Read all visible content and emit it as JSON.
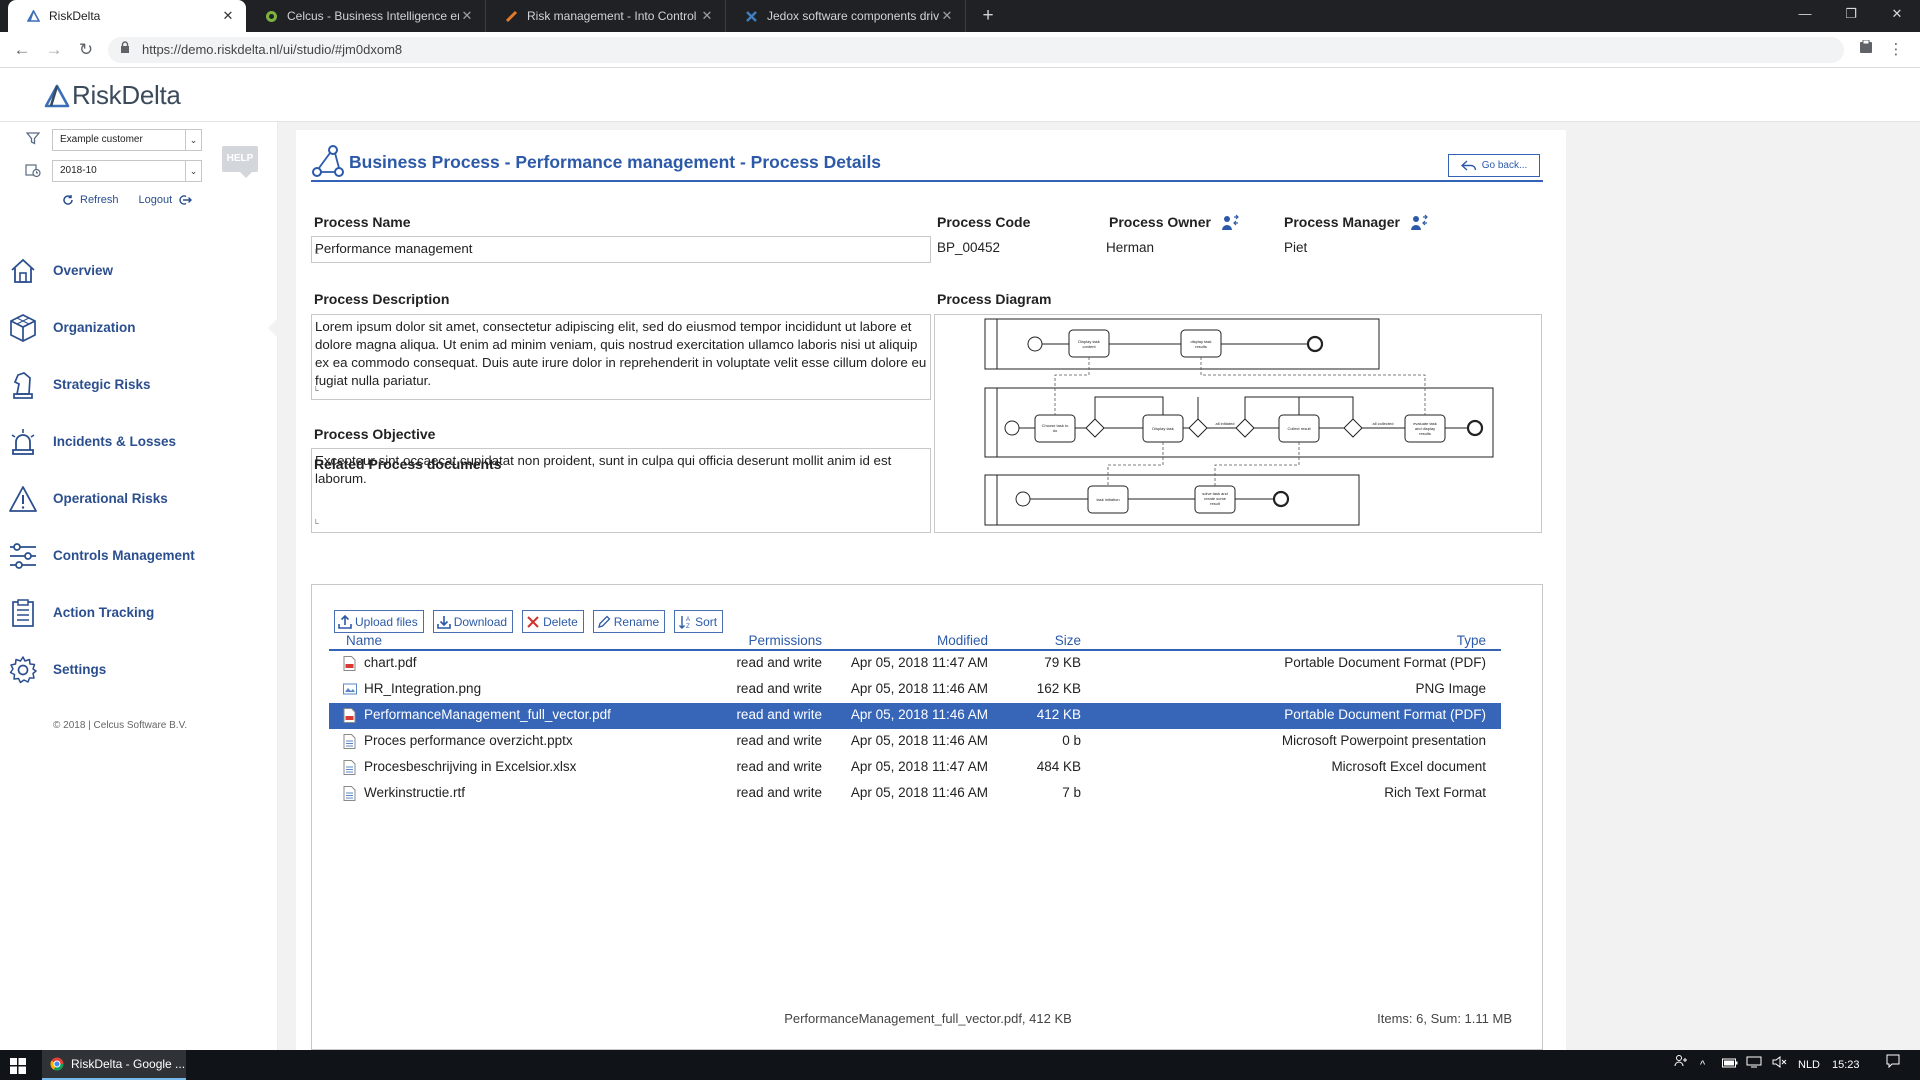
{
  "browser": {
    "tabs": [
      {
        "label": "RiskDelta",
        "favicon": "riskdelta-favicon",
        "active": true
      },
      {
        "label": "Celcus - Business Intelligence en",
        "favicon": "celcus-favicon",
        "active": false
      },
      {
        "label": "Risk management - Into Control",
        "favicon": "intocontrol-favicon",
        "active": false
      },
      {
        "label": "Jedox software components driv",
        "favicon": "jedox-favicon",
        "active": false
      }
    ],
    "url": "https://demo.riskdelta.nl/ui/studio/#jm0dxom8"
  },
  "app": {
    "logo_text": "RiskDelta",
    "brand_color": "#2c5aa8"
  },
  "sidebar": {
    "customer_select": "Example customer",
    "period_select": "2018-10",
    "help_label": "HELP",
    "refresh_label": "Refresh",
    "logout_label": "Logout",
    "items": [
      {
        "label": "Overview",
        "icon": "home-icon"
      },
      {
        "label": "Organization",
        "icon": "cube-icon"
      },
      {
        "label": "Strategic Risks",
        "icon": "chess-knight-icon"
      },
      {
        "label": "Incidents & Losses",
        "icon": "alarm-light-icon"
      },
      {
        "label": "Operational Risks",
        "icon": "warning-icon"
      },
      {
        "label": "Controls Management",
        "icon": "sliders-icon"
      },
      {
        "label": "Action Tracking",
        "icon": "clipboard-icon"
      },
      {
        "label": "Settings",
        "icon": "gear-icon"
      }
    ],
    "copyright": "© 2018 | Celcus Software B.V."
  },
  "process": {
    "title": "Business Process - Performance management - Process Details",
    "go_back_label": "Go back...",
    "name_label": "Process Name",
    "name_value": "Performance management",
    "code_label": "Process Code",
    "code_value": "BP_00452",
    "owner_label": "Process Owner",
    "owner_value": "Herman",
    "manager_label": "Process Manager",
    "manager_value": "Piet",
    "description_label": "Process Description",
    "description_value": "Lorem ipsum dolor sit amet, consectetur adipiscing elit, sed do eiusmod tempor incididunt ut labore et dolore magna aliqua. Ut enim ad minim veniam, quis nostrud exercitation ullamco laboris nisi ut aliquip ex ea commodo consequat. Duis aute irure dolor in reprehenderit in voluptate velit esse cillum dolore eu fugiat nulla pariatur.",
    "objective_label": "Process Objective",
    "objective_value": "Excepteur sint occaecat cupidatat non proident, sunt in culpa qui officia deserunt mollit anim id est laborum.",
    "diagram_label": "Process Diagram"
  },
  "documents": {
    "section_label": "Related Process documents",
    "toolbar": {
      "upload": "Upload files",
      "download": "Download",
      "delete": "Delete",
      "rename": "Rename",
      "sort": "Sort"
    },
    "columns": {
      "name": "Name",
      "permissions": "Permissions",
      "modified": "Modified",
      "size": "Size",
      "type": "Type"
    },
    "rows": [
      {
        "name": "chart.pdf",
        "permissions": "read and write",
        "modified": "Apr 05, 2018 11:47 AM",
        "size": "79 KB",
        "type": "Portable Document Format (PDF)",
        "icon": "pdf-icon",
        "selected": false
      },
      {
        "name": "HR_Integration.png",
        "permissions": "read and write",
        "modified": "Apr 05, 2018 11:46 AM",
        "size": "162 KB",
        "type": "PNG Image",
        "icon": "image-icon",
        "selected": false
      },
      {
        "name": "PerformanceManagement_full_vector.pdf",
        "permissions": "read and write",
        "modified": "Apr 05, 2018 11:46 AM",
        "size": "412 KB",
        "type": "Portable Document Format (PDF)",
        "icon": "pdf-icon",
        "selected": true
      },
      {
        "name": "Proces performance overzicht.pptx",
        "permissions": "read and write",
        "modified": "Apr 05, 2018 11:46 AM",
        "size": "0 b",
        "type": "Microsoft Powerpoint presentation",
        "icon": "document-icon",
        "selected": false
      },
      {
        "name": "Procesbeschrijving in Excelsior.xlsx",
        "permissions": "read and write",
        "modified": "Apr 05, 2018 11:47 AM",
        "size": "484 KB",
        "type": "Microsoft Excel document",
        "icon": "document-icon",
        "selected": false
      },
      {
        "name": "Werkinstructie.rtf",
        "permissions": "read and write",
        "modified": "Apr 05, 2018 11:46 AM",
        "size": "7 b",
        "type": "Rich Text Format",
        "icon": "document-icon",
        "selected": false
      }
    ],
    "status_selected": "PerformanceManagement_full_vector.pdf, 412 KB",
    "status_summary": "Items: 6, Sum: 1.11 MB"
  },
  "taskbar": {
    "app_label": "RiskDelta - Google ...",
    "language": "NLD",
    "time": "15:23"
  }
}
